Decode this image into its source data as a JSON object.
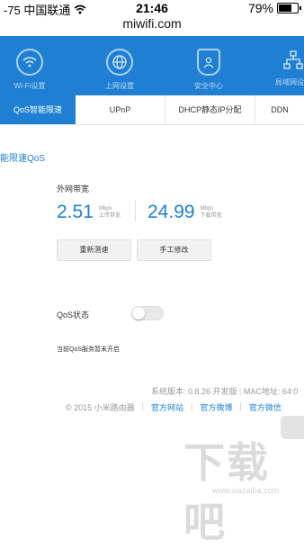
{
  "status_bar": {
    "carrier": "-75 中国联通",
    "time": "21:46",
    "battery": "79%",
    "battery_level": 0.79
  },
  "browser": {
    "url": "miwifi.com"
  },
  "top_nav": [
    {
      "label": "Wi-Fi设置",
      "icon": "wifi-icon"
    },
    {
      "label": "上网设置",
      "icon": "globe-icon"
    },
    {
      "label": "安全中心",
      "icon": "shield-icon"
    },
    {
      "label": "局域网设置",
      "icon": "network-icon"
    }
  ],
  "tabs": [
    {
      "label": "QoS智能限速",
      "active": true
    },
    {
      "label": "UPnP",
      "active": false
    },
    {
      "label": "DHCP静态IP分配",
      "active": false
    },
    {
      "label": "DDN",
      "active": false
    }
  ],
  "main": {
    "section_title": "能限速QoS",
    "bandwidth": {
      "title": "外网带宽",
      "upload": {
        "value": "2.51",
        "unit": "Mbps",
        "label": "上传带宽"
      },
      "download": {
        "value": "24.99",
        "unit": "Mbps",
        "label": "下载带宽"
      }
    },
    "buttons": {
      "retest": "重新测速",
      "manual": "手工修改"
    },
    "qos": {
      "label": "QoS状态",
      "enabled": false,
      "note": "当前QoS服务暂未开启"
    }
  },
  "footer": {
    "version": "系统版本: 0.8.26 开发版",
    "mac": "MAC地址: 64:0",
    "copyright": "© 2015 小米路由器",
    "links": [
      "官方网站",
      "官方微博",
      "官方微信"
    ]
  },
  "watermark": {
    "main": "下载吧",
    "sub": "www.xiazaiba.com"
  }
}
